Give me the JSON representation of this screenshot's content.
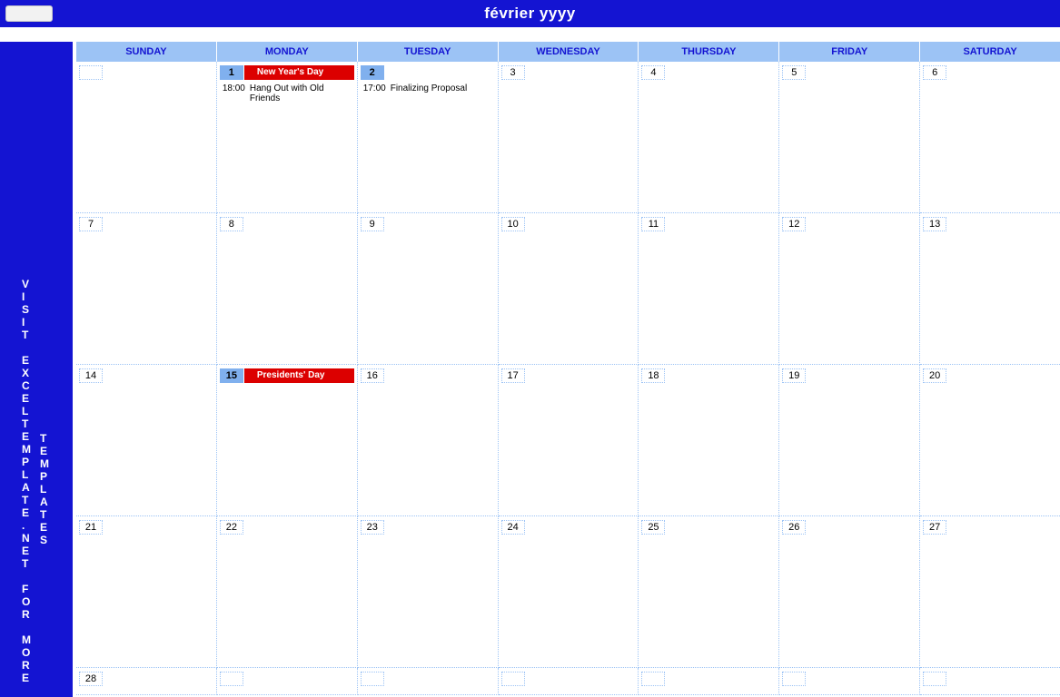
{
  "header": {
    "title": "février yyyy",
    "input_placeholder": ""
  },
  "sidebar": {
    "line1": "V\nI\nS\nI\nT\n \nE\nX\nC\nE\nL\nT\nE\nM\nP\nL\nA\nT\nE\n.\nN\nE\nT\n \nF\nO\nR\n \nM\nO\nR\nE",
    "line2": "T\nE\nM\nP\nL\nA\nT\nE\nS"
  },
  "days": [
    "SUNDAY",
    "MONDAY",
    "TUESDAY",
    "WEDNESDAY",
    "THURSDAY",
    "FRIDAY",
    "SATURDAY"
  ],
  "weeks": [
    [
      {
        "num": ""
      },
      {
        "num": "1",
        "hl": true,
        "holiday": "New Year's Day",
        "events": [
          {
            "time": "18:00",
            "text": "Hang Out with Old Friends"
          }
        ]
      },
      {
        "num": "2",
        "hl": true,
        "events": [
          {
            "time": "17:00",
            "text": "Finalizing Proposal"
          }
        ]
      },
      {
        "num": "3"
      },
      {
        "num": "4"
      },
      {
        "num": "5"
      },
      {
        "num": "6"
      }
    ],
    [
      {
        "num": "7"
      },
      {
        "num": "8"
      },
      {
        "num": "9"
      },
      {
        "num": "10"
      },
      {
        "num": "11"
      },
      {
        "num": "12"
      },
      {
        "num": "13"
      }
    ],
    [
      {
        "num": "14"
      },
      {
        "num": "15",
        "hl": true,
        "holiday": "Presidents' Day"
      },
      {
        "num": "16"
      },
      {
        "num": "17"
      },
      {
        "num": "18"
      },
      {
        "num": "19"
      },
      {
        "num": "20"
      }
    ],
    [
      {
        "num": "21"
      },
      {
        "num": "22"
      },
      {
        "num": "23"
      },
      {
        "num": "24"
      },
      {
        "num": "25"
      },
      {
        "num": "26"
      },
      {
        "num": "27"
      }
    ],
    [
      {
        "num": "28"
      },
      {
        "num": ""
      },
      {
        "num": ""
      },
      {
        "num": ""
      },
      {
        "num": ""
      },
      {
        "num": ""
      },
      {
        "num": ""
      }
    ]
  ]
}
